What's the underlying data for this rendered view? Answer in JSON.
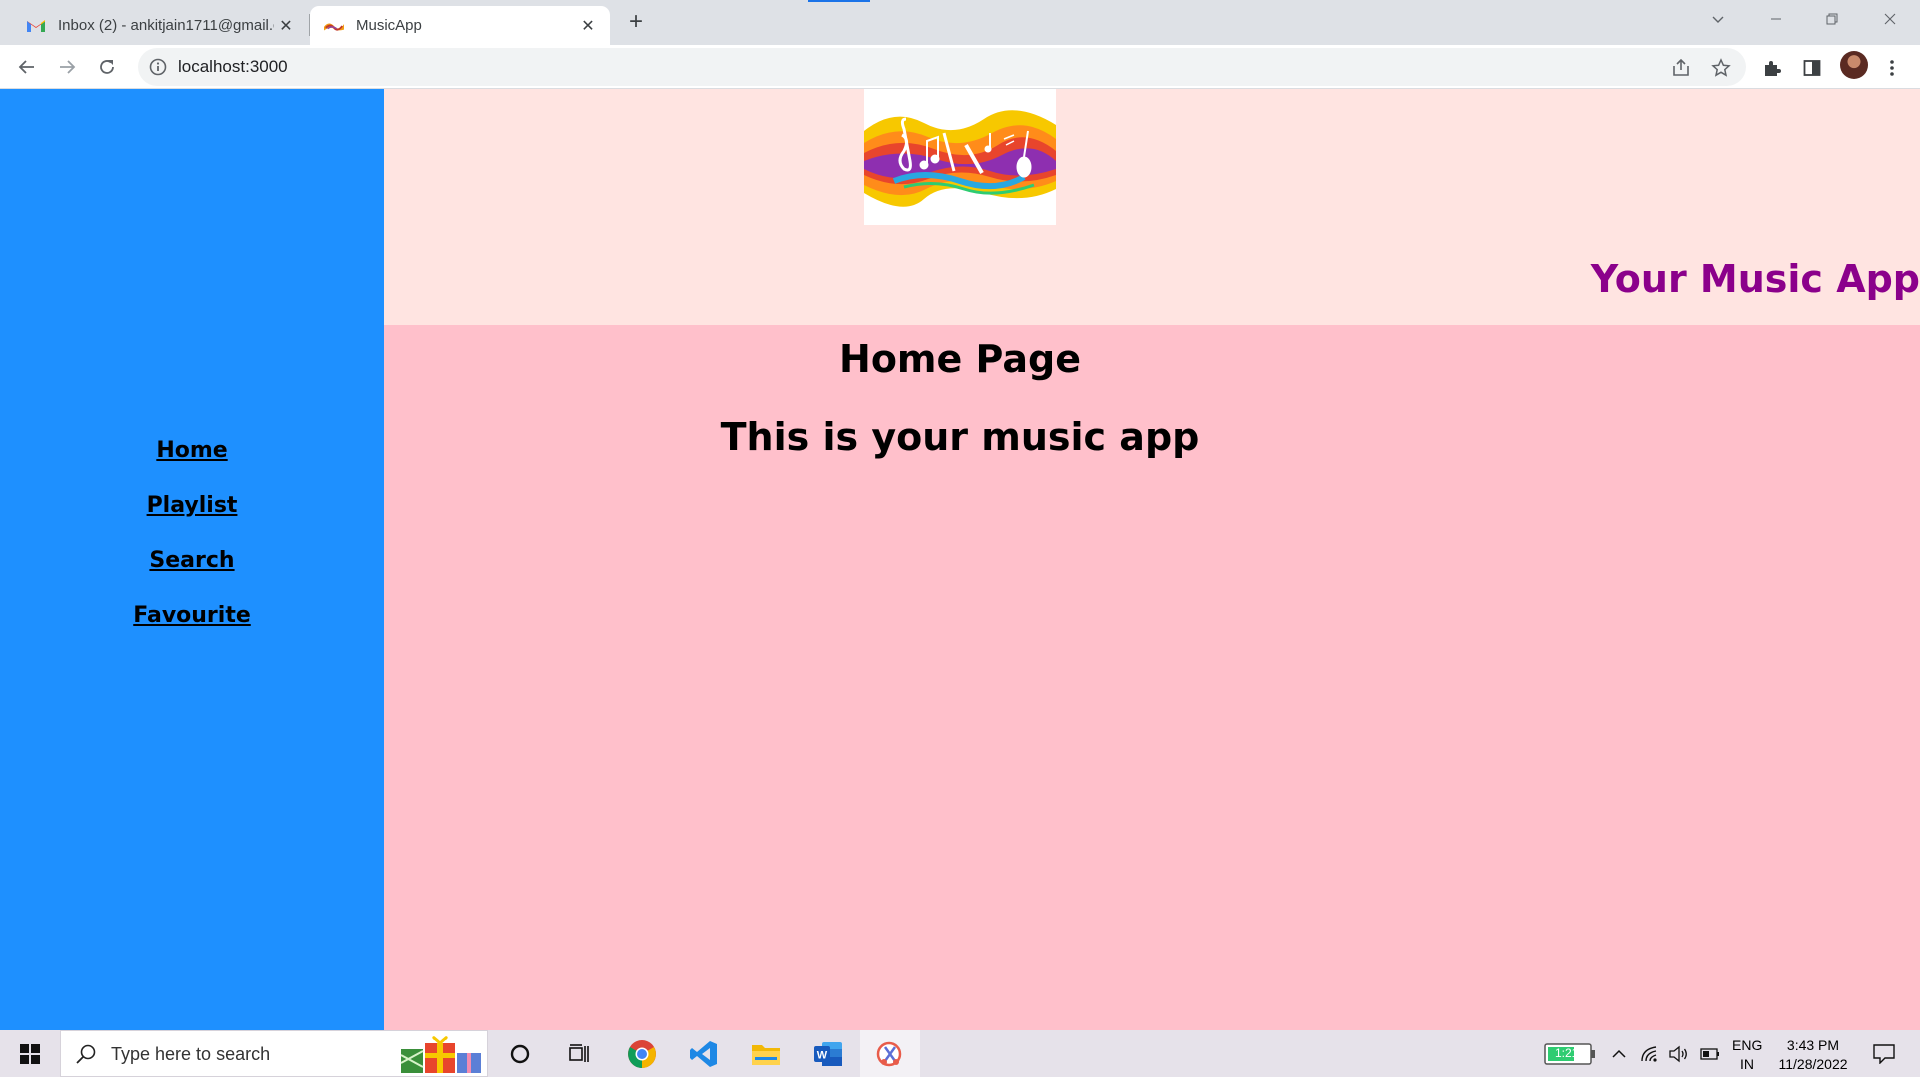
{
  "browser": {
    "tabs": [
      {
        "title": "Inbox (2) - ankitjain1711@gmail.c",
        "favicon": "gmail-icon",
        "active": false
      },
      {
        "title": "MusicApp",
        "favicon": "music-app-favicon",
        "active": true
      }
    ],
    "url": "localhost:3000"
  },
  "app": {
    "nav": [
      {
        "label": "Home"
      },
      {
        "label": "Playlist"
      },
      {
        "label": "Search"
      },
      {
        "label": "Favourite"
      }
    ],
    "title": "Your Music App",
    "heading": "Home Page",
    "subheading": "This is your music app",
    "colors": {
      "sidebar": "#1e90ff",
      "header": "#ffe4e1",
      "main": "#ffc0cb",
      "title": "#8b008b"
    }
  },
  "taskbar": {
    "search_placeholder": "Type here to search",
    "battery": "1:21",
    "lang_top": "ENG",
    "lang_bottom": "IN",
    "time": "3:43 PM",
    "date": "11/28/2022"
  }
}
